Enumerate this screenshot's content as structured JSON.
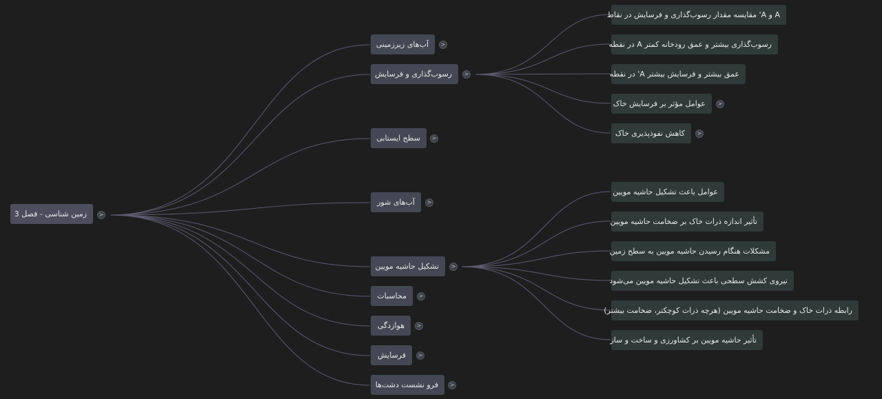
{
  "colors": {
    "background": "#1e1e1e",
    "root_node": "#4d4d5e",
    "level1_node": "#434854",
    "level2_node": "#2f3a39",
    "edge": "#5c5b70"
  },
  "toggle_glyph": ">",
  "root": {
    "label": "زمین شناسی - فصل 3"
  },
  "level1": [
    {
      "label": "آب‌های زیرزمینی"
    },
    {
      "label": "رسوب‌گذاری و فرسایش"
    },
    {
      "label": "سطح ایستابی"
    },
    {
      "label": "آب‌های شور"
    },
    {
      "label": "تشکیل حاشیه مویین"
    },
    {
      "label": "محاسبات"
    },
    {
      "label": "هوازدگی"
    },
    {
      "label": "فرسایش"
    },
    {
      "label": "فرو نشست دشت‌ها"
    }
  ],
  "sediment_children": [
    {
      "label": "A و A' مقایسه مقدار رسوب‌گذاری و فرسایش در نقاط"
    },
    {
      "label": "رسوب‌گذاری بیشتر و عمق رودخانه کمتر A در نقطه"
    },
    {
      "label": "عمق بیشتر و فرسایش بیشتر A' در نقطه"
    },
    {
      "label": "عوامل مؤثر بر فرسایش خاک"
    },
    {
      "label": "کاهش نفوذپذیری خاک"
    }
  ],
  "capillary_children": [
    {
      "label": "عوامل باعث تشکیل حاشیه مویین"
    },
    {
      "label": "تأثیر اندازه ذرات خاک بر ضخامت حاشیه مویین"
    },
    {
      "label": "مشکلات هنگام رسیدن حاشیه مویین به سطح زمین"
    },
    {
      "label": "نیروی کشش سطحی باعث تشکیل حاشیه مویین می‌شود"
    },
    {
      "label": "رابطه ذرات خاک و ضخامت حاشیه مویین (هرچه ذرات کوچکتر، ضخامت بیشتر)"
    },
    {
      "label": "تأثیر حاشیه مویین بر کشاورزی و ساخت و ساز"
    }
  ]
}
